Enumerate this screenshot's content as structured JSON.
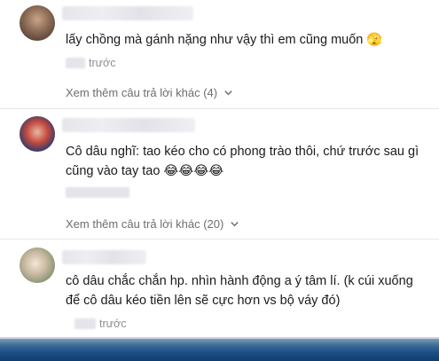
{
  "comments": [
    {
      "text": "lấy chồng mà gánh nặng như vậy thì em cũng muốn 🫣",
      "time_suffix": "trước",
      "replies_label": "Xem thêm câu trả lời khác (4)"
    },
    {
      "text": "Cô dâu nghĩ: tao kéo cho có phong trào thôi, chứ trước sau gì cũng vào tay tao 😂😂😂😂",
      "replies_label": "Xem thêm câu trả lời khác (20)"
    },
    {
      "text": "cô dâu chắc chắn hp. nhìn hành động a ý tâm lí. (k cúi xuống để cô dâu kéo tiền lên sẽ cực hơn vs bộ váy đó)",
      "time_suffix": "trước"
    }
  ],
  "icons": {
    "chevron": "chevron-down-icon"
  },
  "colors": {
    "text": "#1a1a1a",
    "meta": "#8e8e95",
    "taskbar": "#1e4f86"
  }
}
